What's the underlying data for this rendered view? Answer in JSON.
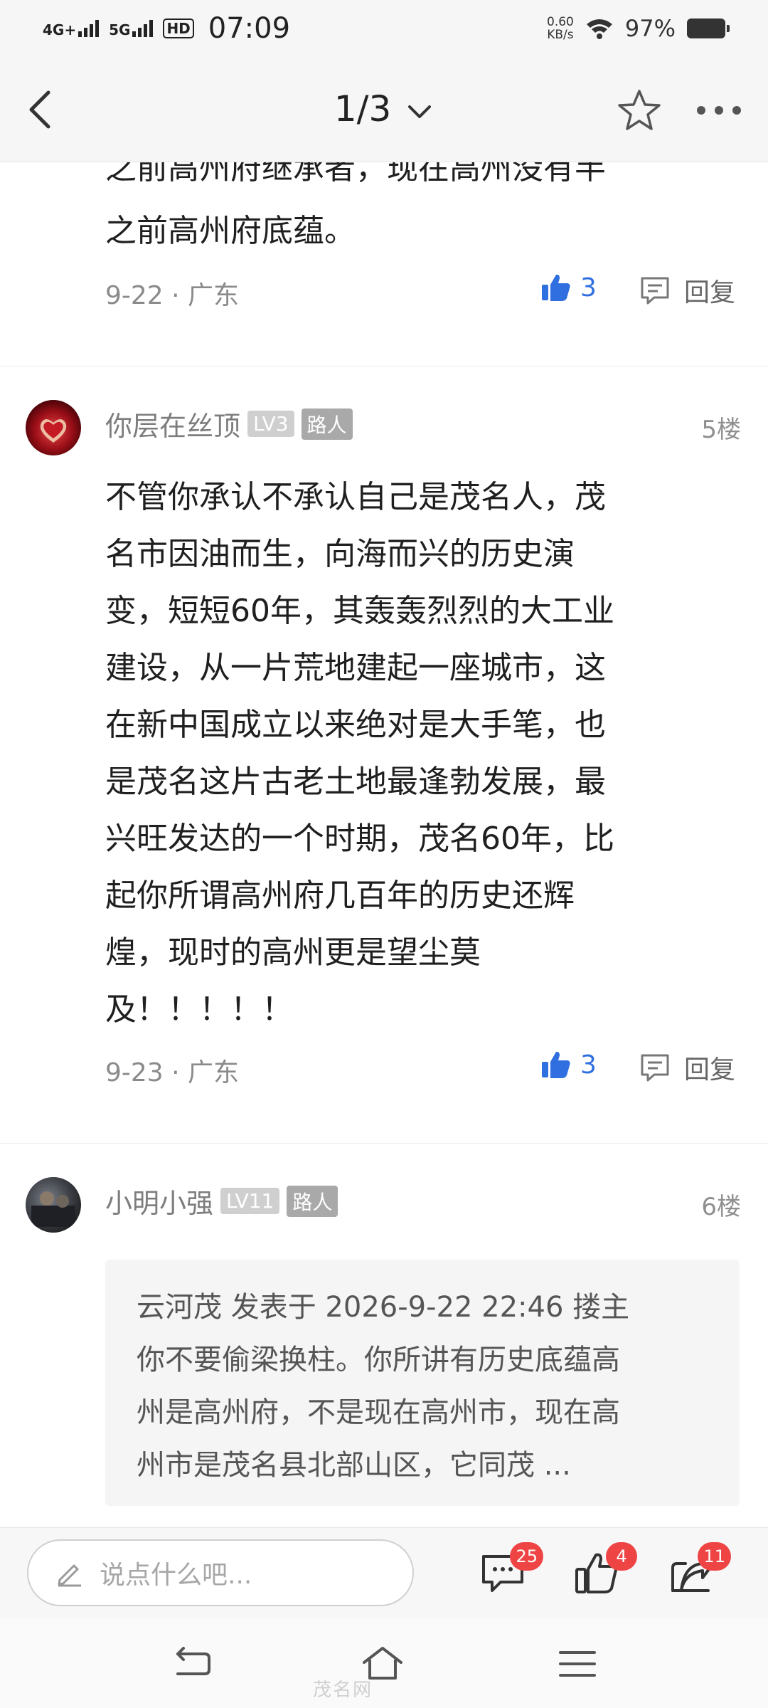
{
  "status_bar": {
    "signal1": "4G+",
    "signal2": "5G",
    "hd": "HD",
    "time": "07:09",
    "speed_value": "0.60",
    "speed_unit": "KB/s",
    "battery": "97%"
  },
  "header": {
    "pager": "1/3"
  },
  "post_prev": {
    "text_lines": [
      "之前高州府继承者，现在高州没有半",
      "之前高州府底蕴。"
    ],
    "date": "9-22",
    "location": "广东",
    "likes": "3",
    "reply_label": "回复"
  },
  "post5": {
    "username": "你层在丝顶",
    "level": "LV3",
    "role": "路人",
    "floor": "5楼",
    "text_lines": [
      "不管你承认不承认自己是茂名人，茂",
      "名市因油而生，向海而兴的历史演",
      "变，短短60年，其轰轰烈烈的大工业",
      "建设，从一片荒地建起一座城市，这",
      "在新中国成立以来绝对是大手笔，也",
      "是茂名这片古老土地最逢勃发展，最",
      "兴旺发达的一个时期，茂名60年，比",
      "起你所谓高州府几百年的历史还辉",
      "煌，现时的高州更是望尘莫",
      "及！！！！！"
    ],
    "date": "9-23",
    "location": "广东",
    "likes": "3",
    "reply_label": "回复"
  },
  "post6": {
    "username": "小明小强",
    "level": "LV11",
    "role": "路人",
    "floor": "6楼",
    "quote_lines": [
      "云河茂 发表于 2026-9-22 22:46 搂主",
      "你不要偷梁换柱。你所讲有历史底蕴高",
      "州是高州府，不是现在高州市，现在高",
      "州市是茂名县北部山区，它同茂 ..."
    ]
  },
  "comment_bar": {
    "placeholder": "说点什么吧...",
    "comments_count": "25",
    "likes_count": "4",
    "shares_count": "11"
  },
  "watermark": "茂名网"
}
